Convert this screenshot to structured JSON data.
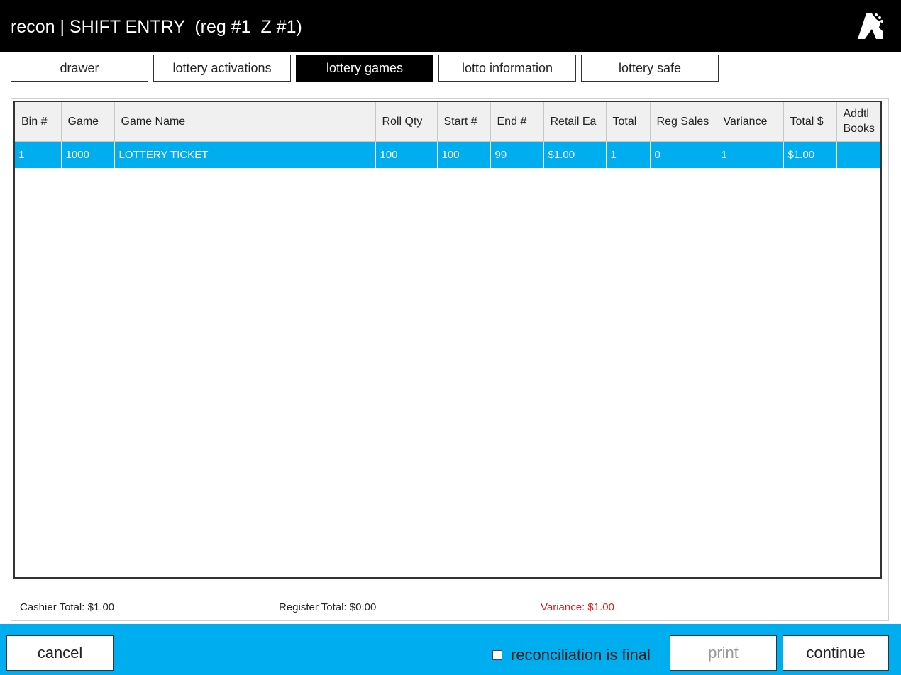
{
  "header": {
    "title": "recon | SHIFT ENTRY  (reg #1  Z #1)",
    "logo_icon": "app-logo-icon"
  },
  "tabs": [
    {
      "label": "drawer",
      "active": false
    },
    {
      "label": "lottery activations",
      "active": false
    },
    {
      "label": "lottery games",
      "active": true
    },
    {
      "label": "lotto information",
      "active": false
    },
    {
      "label": "lottery safe",
      "active": false
    }
  ],
  "table": {
    "columns": [
      "Bin #",
      "Game",
      "Game Name",
      "Roll Qty",
      "Start #",
      "End #",
      "Retail Ea",
      "Total",
      "Reg Sales",
      "Variance",
      "Total $",
      "Addtl Books"
    ],
    "rows": [
      [
        "1",
        "1000",
        "LOTTERY TICKET",
        "100",
        "100",
        "99",
        "$1.00",
        "1",
        "0",
        "1",
        "$1.00",
        ""
      ]
    ]
  },
  "totals": {
    "cashier": "Cashier Total: $1.00",
    "register": "Register Total: $0.00",
    "variance": "Variance: $1.00"
  },
  "footer": {
    "cancel_label": "cancel",
    "final_label": "reconciliation is final",
    "final_checked": false,
    "print_label": "print",
    "continue_label": "continue"
  },
  "colors": {
    "accent": "#00aeef",
    "titlebar": "#000000",
    "variance_text": "#e81818"
  }
}
